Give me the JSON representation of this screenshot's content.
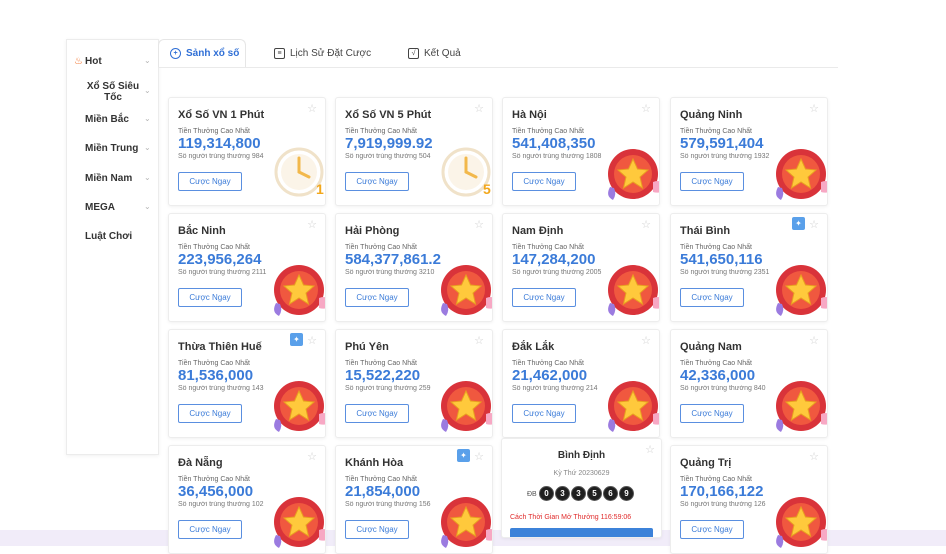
{
  "sidebar": {
    "items": [
      {
        "label": "Hot",
        "icon": "fire-icon"
      },
      {
        "label": "Xổ Số Siêu Tốc"
      },
      {
        "label": "Miền Bắc"
      },
      {
        "label": "Miền Trung"
      },
      {
        "label": "Miền Nam"
      },
      {
        "label": "MEGA"
      },
      {
        "label": "Luật Chơi"
      }
    ]
  },
  "tabs": [
    {
      "label": "Sảnh xổ số",
      "active": true
    },
    {
      "label": "Lịch Sử Đặt Cược",
      "active": false
    },
    {
      "label": "Kết Quả",
      "active": false
    }
  ],
  "common": {
    "prize_label": "Tiền Thưởng Cao Nhất",
    "bet_label": "Cược Ngay"
  },
  "cards": [
    {
      "title": "Xổ Số VN 1 Phút",
      "amount": "119,314,800",
      "winners": "Số người trúng thưởng 984",
      "art": "clock-1"
    },
    {
      "title": "Xổ Số VN 5 Phút",
      "amount": "7,919,999.92",
      "winners": "Số người trúng thưởng 504",
      "art": "clock-5"
    },
    {
      "title": "Hà Nội",
      "amount": "541,408,350",
      "winners": "Số người trúng thưởng 1808",
      "art": "star"
    },
    {
      "title": "Quảng Ninh",
      "amount": "579,591,404",
      "winners": "Số người trúng thưởng 1932",
      "art": "star"
    },
    {
      "title": "Bắc Ninh",
      "amount": "223,956,264",
      "winners": "Số người trúng thưởng 2111",
      "art": "star"
    },
    {
      "title": "Hải Phòng",
      "amount": "584,377,861.2",
      "winners": "Số người trúng thưởng 3210",
      "art": "star"
    },
    {
      "title": "Nam Định",
      "amount": "147,284,200",
      "winners": "Số người trúng thưởng 2005",
      "art": "star"
    },
    {
      "title": "Thái Bình",
      "amount": "541,650,116",
      "winners": "Số người trúng thưởng 2351",
      "art": "star",
      "badge": true
    },
    {
      "title": "Thừa Thiên Huế",
      "amount": "81,536,000",
      "winners": "Số người trúng thưởng 143",
      "art": "star",
      "badge": true
    },
    {
      "title": "Phú Yên",
      "amount": "15,522,220",
      "winners": "Số người trúng thưởng 259",
      "art": "star"
    },
    {
      "title": "Đắk Lắk",
      "amount": "21,462,000",
      "winners": "Số người trúng thưởng 214",
      "art": "star"
    },
    {
      "title": "Quảng Nam",
      "amount": "42,336,000",
      "winners": "Số người trúng thưởng 840",
      "art": "star"
    },
    {
      "title": "Đà Nẵng",
      "amount": "36,456,000",
      "winners": "Số người trúng thưởng 102",
      "art": "star"
    },
    {
      "title": "Khánh Hòa",
      "amount": "21,854,000",
      "winners": "Số người trúng thưởng 156",
      "art": "star",
      "badge": true
    },
    {
      "title": "Quảng Trị",
      "amount": "170,166,122",
      "winners": "Số người trúng thưởng 126",
      "art": "star"
    }
  ],
  "special": {
    "title": "Bình Định",
    "period": "Kỳ Thứ 20230629",
    "db_label": "ĐB",
    "balls": [
      "0",
      "3",
      "3",
      "5",
      "6",
      "9"
    ],
    "countdown": "Cách Thời Gian Mở Thưởng 116:59:06"
  },
  "colors": {
    "accent": "#3b7bd8",
    "countdown": "#e02b2b",
    "fire": "#f26b21"
  }
}
